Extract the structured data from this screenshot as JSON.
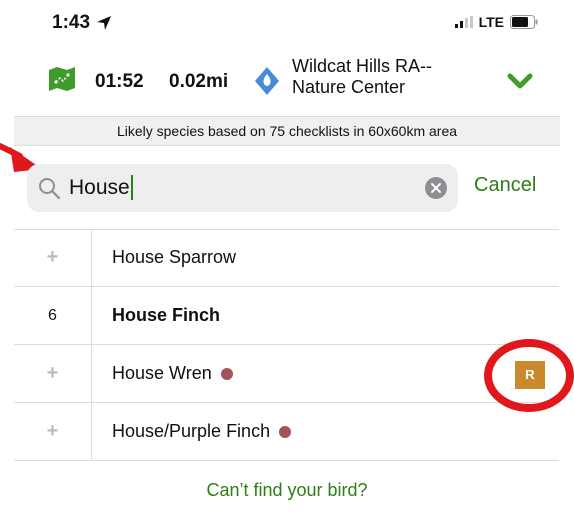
{
  "status_bar": {
    "time": "1:43",
    "network": "LTE"
  },
  "checklist": {
    "timer": "01:52",
    "distance": "0.02mi",
    "location_line1": "Wildcat Hills RA--",
    "location_line2": "Nature Center"
  },
  "banner": {
    "text": "Likely species based on 75 checklists in 60x60km area"
  },
  "search": {
    "value": "House",
    "cancel_label": "Cancel"
  },
  "species": [
    {
      "count": "",
      "name": "House Sparrow",
      "bold": false,
      "rare": false
    },
    {
      "count": "6",
      "name": "House Finch",
      "bold": true,
      "rare": false
    },
    {
      "count": "",
      "name": "House Wren",
      "bold": false,
      "rare": true
    },
    {
      "count": "",
      "name": "House/Purple Finch",
      "bold": false,
      "rare": true
    }
  ],
  "rare_badge": {
    "label": "R"
  },
  "footer": {
    "cant_find_label": "Can’t find your bird?"
  },
  "colors": {
    "accent_green": "#2e7d16",
    "rare_dot": "#a4525a",
    "rare_badge": "#c98a2e",
    "annotation_red": "#e0171b",
    "location_blue": "#4a8ad8"
  },
  "icons": {
    "location_arrow": "location-arrow-icon",
    "signal": "signal-bars-icon",
    "battery": "battery-icon",
    "map": "map-icon",
    "location_pin": "location-pin-icon",
    "chevron": "chevron-down-icon",
    "search": "search-icon",
    "clear": "clear-icon",
    "plus": "plus-icon"
  }
}
